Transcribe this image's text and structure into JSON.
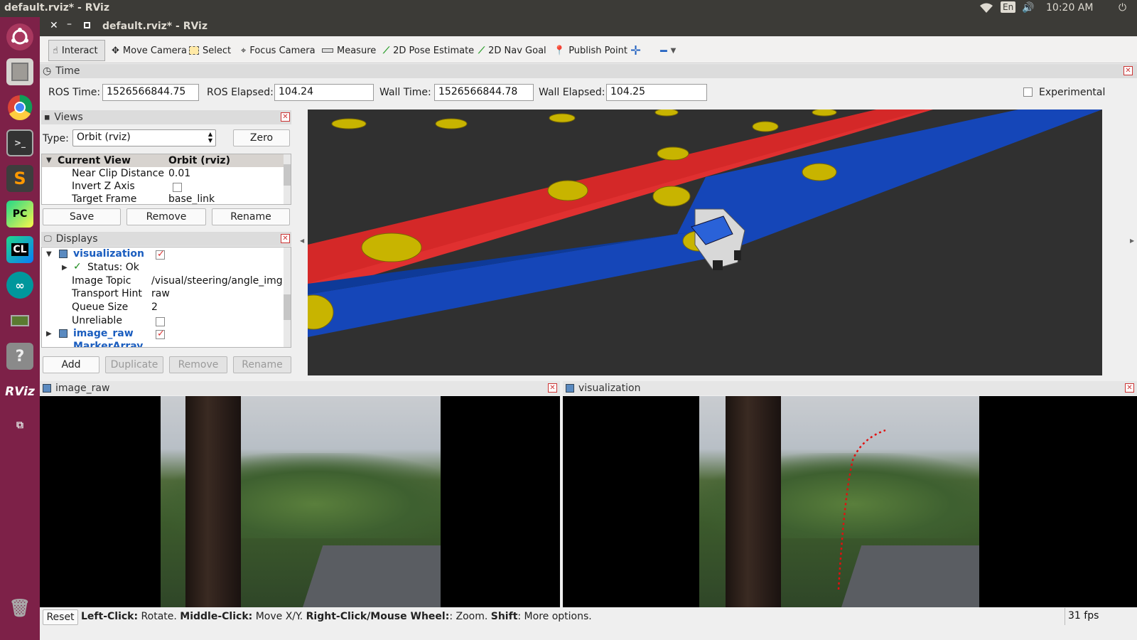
{
  "system_bar": {
    "title": "default.rviz* - RViz",
    "lang": "En",
    "time": "10:20 AM"
  },
  "launcher": {
    "items": [
      "ubuntu-dash",
      "files",
      "chrome",
      "terminal",
      "sublime-text",
      "pycharm",
      "clion",
      "arduino",
      "system-monitor",
      "help",
      "rviz",
      "workspace-switcher",
      "trash"
    ],
    "rviz_label": "RViz",
    "pc_label": "PC",
    "cl_label": "CL"
  },
  "window": {
    "title": "default.rviz* - RViz"
  },
  "toolbar": {
    "interact": "Interact",
    "move_camera": "Move Camera",
    "select": "Select",
    "focus_camera": "Focus Camera",
    "measure": "Measure",
    "pose_estimate": "2D Pose Estimate",
    "nav_goal": "2D Nav Goal",
    "publish_point": "Publish Point"
  },
  "time_panel": {
    "title": "Time",
    "ros_time_label": "ROS Time:",
    "ros_time": "1526566844.75",
    "ros_elapsed_label": "ROS Elapsed:",
    "ros_elapsed": "104.24",
    "wall_time_label": "Wall Time:",
    "wall_time": "1526566844.78",
    "wall_elapsed_label": "Wall Elapsed:",
    "wall_elapsed": "104.25",
    "experimental": "Experimental"
  },
  "views_panel": {
    "title": "Views",
    "type_label": "Type:",
    "type_value": "Orbit (rviz)",
    "zero": "Zero",
    "header_name": "Current View",
    "header_value": "Orbit (rviz)",
    "rows": [
      {
        "name": "Near Clip Distance",
        "value": "0.01"
      },
      {
        "name": "Invert Z Axis",
        "value": ""
      },
      {
        "name": "Target Frame",
        "value": "base_link"
      }
    ],
    "save": "Save",
    "remove": "Remove",
    "rename": "Rename"
  },
  "displays_panel": {
    "title": "Displays",
    "visualization": "visualization",
    "status": "Status: Ok",
    "rows": [
      {
        "name": "Image Topic",
        "value": "/visual/steering/angle_img"
      },
      {
        "name": "Transport Hint",
        "value": "raw"
      },
      {
        "name": "Queue Size",
        "value": "2"
      },
      {
        "name": "Unreliable",
        "value": ""
      }
    ],
    "image_raw": "image_raw",
    "marker_array": "MarkerArray",
    "add": "Add",
    "duplicate": "Duplicate",
    "remove": "Remove",
    "rename": "Rename"
  },
  "image_panels": {
    "left": "image_raw",
    "right": "visualization"
  },
  "status_bar": {
    "reset": "Reset",
    "h1": "Left-Click:",
    "t1": " Rotate. ",
    "h2": "Middle-Click:",
    "t2": " Move X/Y. ",
    "h3": "Right-Click/Mouse Wheel:",
    "t3": ": Zoom. ",
    "h4": "Shift",
    "t4": ": More options.",
    "fps": "31 fps"
  },
  "colors": {
    "launcher": "#7d2148",
    "red_lane": "#e03030",
    "blue_lane": "#1546b8",
    "marker": "#c8b400",
    "viewport_bg": "#303030"
  }
}
